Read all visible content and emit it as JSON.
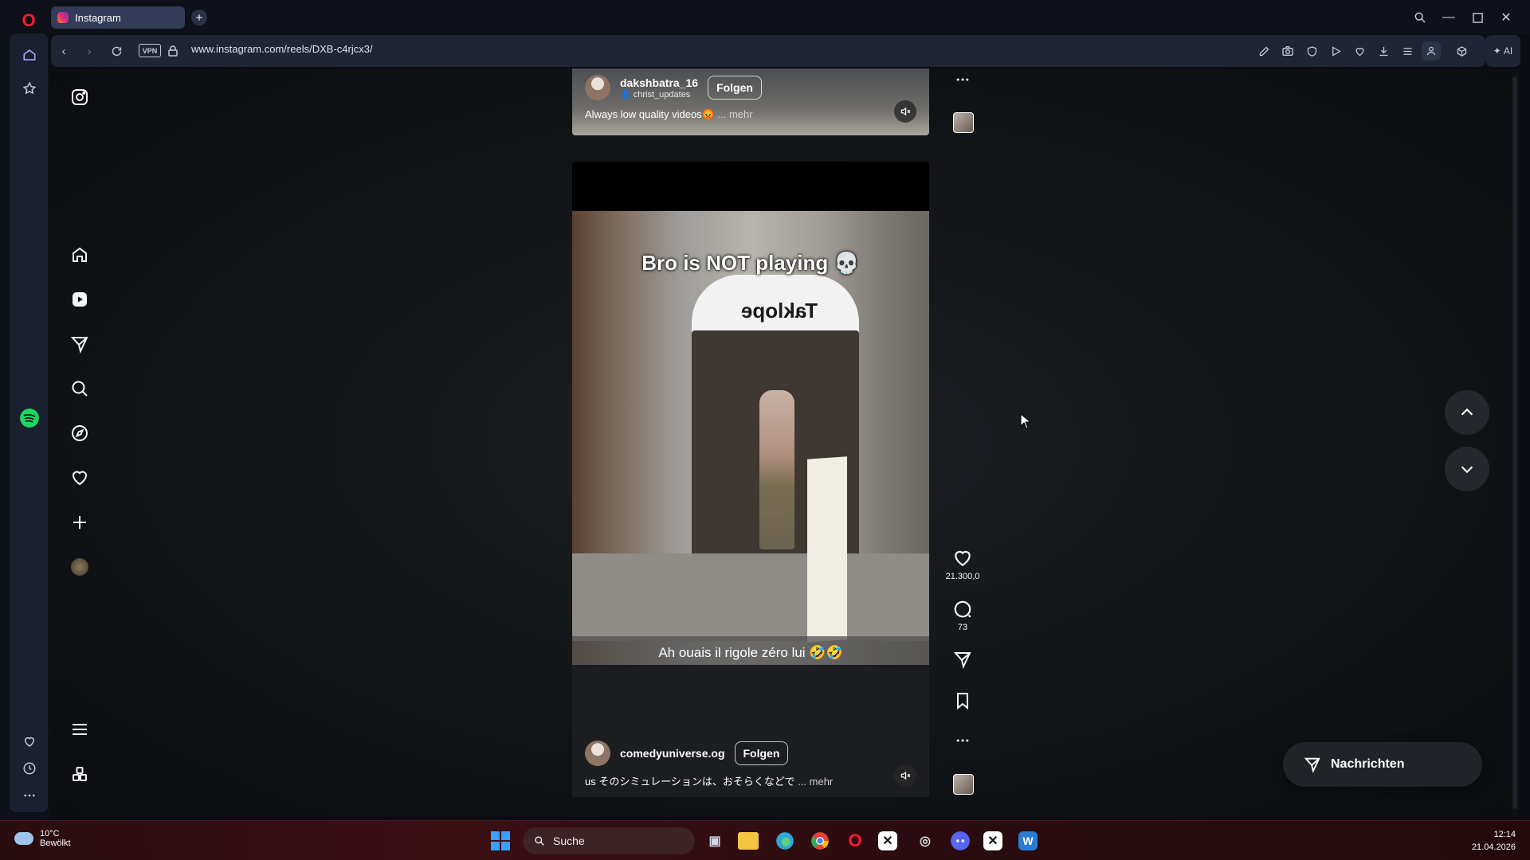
{
  "browser": {
    "tab_title": "Instagram",
    "url": "www.instagram.com/reels/DXB-c4rjcx3/",
    "vpn_label": "VPN",
    "ai_label": "AI"
  },
  "instagram_nav": [
    {
      "name": "home-icon"
    },
    {
      "name": "reels-icon"
    },
    {
      "name": "direct-icon"
    },
    {
      "name": "search-icon"
    },
    {
      "name": "explore-icon"
    },
    {
      "name": "heart-icon"
    },
    {
      "name": "create-icon"
    },
    {
      "name": "profile-avatar"
    }
  ],
  "reel_previous": {
    "username": "dakshbatra_16",
    "collab": "christ_updates",
    "follow_label": "Folgen",
    "caption": "Always low quality videos😡",
    "more_label": "... mehr"
  },
  "reel_current": {
    "overlay_title": "Bro is NOT playing 💀",
    "subtitle": "Ah ouais il rigole zéro lui 🤣🤣",
    "store_sign": "Taklope",
    "username": "comedyuniverse.og",
    "follow_label": "Folgen",
    "caption": "us そのシミュレーションは、おそらくなどで",
    "more_label": "... mehr",
    "likes": "21.300,0",
    "comments": "73"
  },
  "messages_button": "Nachrichten",
  "taskbar": {
    "temperature": "10°C",
    "weather": "Bewölkt",
    "search_label": "Suche",
    "time": "12:14",
    "date": "21.04.2026"
  },
  "colors": {
    "accent_opera": "#ff1b2d",
    "page_bg": "#0f1214",
    "taskbar_bg": "#2a0d10"
  }
}
